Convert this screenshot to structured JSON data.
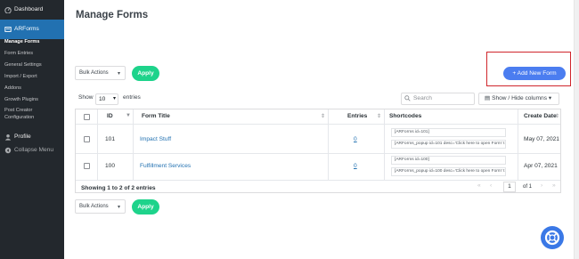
{
  "sidebar": {
    "dashboard": "Dashboard",
    "arforms": "ARForms",
    "submenu": [
      "Manage Forms",
      "Form Entries",
      "General Settings",
      "Import / Export",
      "Addons",
      "Growth Plugins",
      "Post Creator",
      "Configuration"
    ],
    "profile": "Profile",
    "collapse": "Collapse Menu"
  },
  "page": {
    "title": "Manage Forms",
    "bulk_actions": "Bulk Actions",
    "apply": "Apply",
    "add_new": "Add New Form",
    "show": "Show",
    "show_value": "10",
    "entries": "entries",
    "search_placeholder": "Search",
    "show_hide_columns": "Show / Hide columns"
  },
  "table": {
    "headers": {
      "id": "ID",
      "form_title": "Form Title",
      "entries": "Entries",
      "shortcodes": "Shortcodes",
      "create_date": "Create Date"
    },
    "rows": [
      {
        "id": "101",
        "title": "Impact Stuff",
        "entries": "0",
        "shortcode": "[ARForms id=101]",
        "popup": "[ARForms_popup id=101 desc='Click here to open Form' t",
        "date": "May 07, 2021"
      },
      {
        "id": "100",
        "title": "Fulfillment Services",
        "entries": "0",
        "shortcode": "[ARForms id=100]",
        "popup": "[ARForms_popup id=100 desc='Click here to open Form' t",
        "date": "Apr 07, 2021"
      }
    ],
    "info": "Showing 1 to 2 of 2 entries",
    "page": "1",
    "of": "of 1"
  },
  "colors": {
    "accent": "#2271b1",
    "apply_green": "#1ed38b",
    "add_blue": "#4b7df0",
    "highlight_red": "#d0262c",
    "sidebar_bg": "#23282d"
  }
}
